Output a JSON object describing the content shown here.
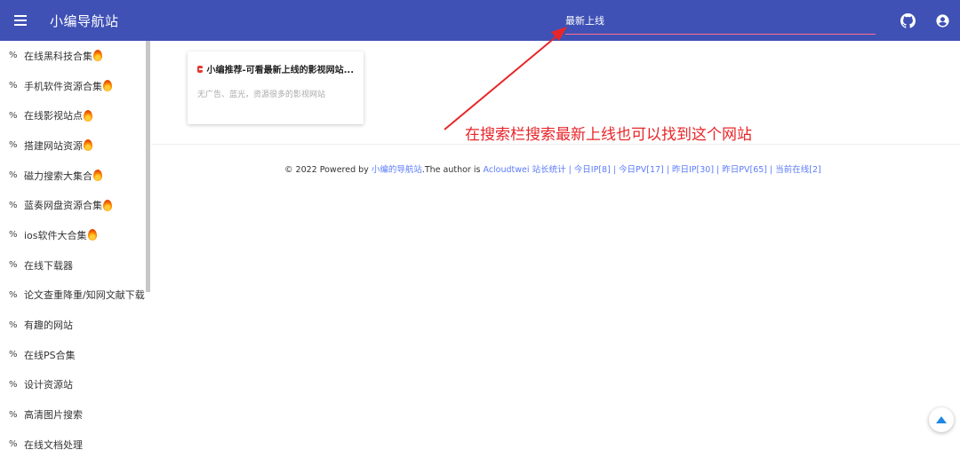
{
  "header": {
    "title": "小编导航站",
    "search_value": "最新上线",
    "github_icon": "github-icon",
    "user_icon": "account-circle-icon"
  },
  "sidebar": {
    "items": [
      {
        "label": "在线黑科技合集",
        "fire": true
      },
      {
        "label": "手机软件资源合集",
        "fire": true
      },
      {
        "label": "在线影视站点",
        "fire": true
      },
      {
        "label": "搭建网站资源",
        "fire": true
      },
      {
        "label": "磁力搜索大集合",
        "fire": true
      },
      {
        "label": "蓝奏网盘资源合集",
        "fire": true
      },
      {
        "label": "ios软件大合集",
        "fire": true
      },
      {
        "label": "在线下载器",
        "fire": false
      },
      {
        "label": "论文查重降重/知网文献下载",
        "fire": false
      },
      {
        "label": "有趣的网站",
        "fire": false
      },
      {
        "label": "在线PS合集",
        "fire": false
      },
      {
        "label": "设计资源站",
        "fire": false
      },
      {
        "label": "高清图片搜索",
        "fire": false
      },
      {
        "label": "在线文档处理",
        "fire": false
      }
    ]
  },
  "card": {
    "title": "小编推荐-可看最新上线的影视网站...",
    "desc": "无广告、蓝光，资源很多的影视网站"
  },
  "footer": {
    "prefix": "© 2022 Powered by ",
    "site_link": "小编的导航站",
    "author_text": ".The author is ",
    "author_link": "Acloudtwei",
    "stats": "站长统计 | 今日IP[8] | 今日PV[17] | 昨日IP[30] | 昨日PV[65] | 当前在线[2]"
  },
  "annotation": {
    "text": "在搜索栏搜索最新上线也可以找到这个网站",
    "color": "#e8262a"
  },
  "colors": {
    "header_bg": "#3f51b5",
    "link": "#5c7cfa",
    "annotation": "#e8262a"
  }
}
